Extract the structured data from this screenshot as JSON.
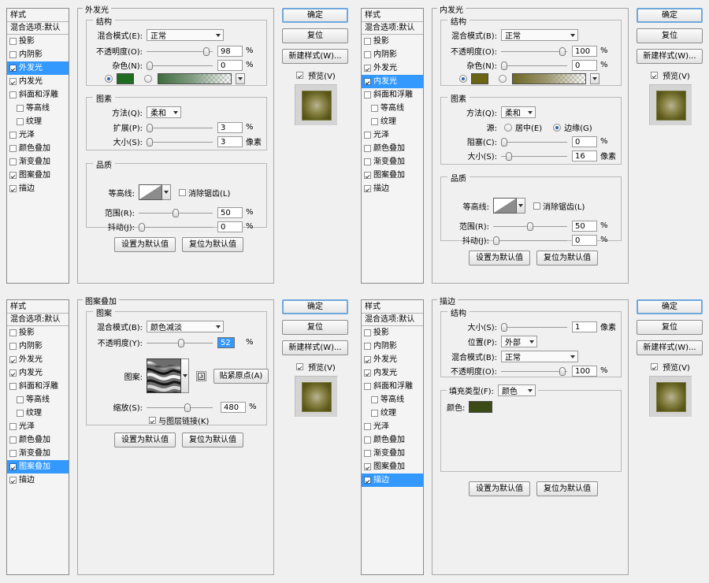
{
  "common": {
    "styles_title": "样式",
    "blend_options": "混合选项:默认",
    "effects": [
      {
        "label": "投影",
        "checked": false,
        "indent": false
      },
      {
        "label": "内阴影",
        "checked": false,
        "indent": false
      },
      {
        "label": "外发光",
        "checked": true,
        "indent": false
      },
      {
        "label": "内发光",
        "checked": true,
        "indent": false
      },
      {
        "label": "斜面和浮雕",
        "checked": false,
        "indent": false
      },
      {
        "label": "等高线",
        "checked": false,
        "indent": true
      },
      {
        "label": "纹理",
        "checked": false,
        "indent": true
      },
      {
        "label": "光泽",
        "checked": false,
        "indent": false
      },
      {
        "label": "颜色叠加",
        "checked": false,
        "indent": false
      },
      {
        "label": "渐变叠加",
        "checked": false,
        "indent": false
      },
      {
        "label": "图案叠加",
        "checked": true,
        "indent": false
      },
      {
        "label": "描边",
        "checked": true,
        "indent": false
      }
    ],
    "buttons": {
      "ok": "确定",
      "reset": "复位",
      "new_style": "新建样式(W)...",
      "preview": "预览(V)",
      "set_default": "设置为默认值",
      "reset_default": "复位为默认值"
    },
    "preview_checked": true,
    "group_structure": "结构",
    "group_elements": "图素",
    "group_quality": "品质",
    "label_blend_mode": "混合模式",
    "label_opacity": "不透明度",
    "label_noise": "杂色",
    "label_method": "方法",
    "label_contour": "等高线",
    "label_antialias": "消除锯齿(L)",
    "label_range": "范围",
    "label_jitter": "抖动",
    "unit_percent": "%",
    "unit_pixel": "像素",
    "accent_selection": "#3399ff"
  },
  "panels": [
    {
      "id": "outer-glow",
      "title": "外发光",
      "selected_effect": "外发光",
      "selected_index": 2,
      "structure": {
        "blend_mode_label": "混合模式(E):",
        "blend_mode_value": "正常",
        "opacity_label": "不透明度(O):",
        "opacity_value": "98",
        "opacity_pct": 98,
        "noise_label": "杂色(N):",
        "noise_value": "0",
        "noise_pct": 0,
        "color_mode": "solid",
        "color": "#1f6b1f",
        "gradient_from": "#4a7a4a",
        "gradient_to": "transparent"
      },
      "elements": {
        "method_label": "方法(Q):",
        "method_value": "柔和",
        "spread_label": "扩展(P):",
        "spread_value": "3",
        "spread_pct": 3,
        "size_label": "大小(S):",
        "size_value": "3",
        "size_pct": 2,
        "size_unit": "像素"
      },
      "quality": {
        "contour_label": "等高线:",
        "antialias_label": "消除锯齿(L)",
        "antialias_checked": false,
        "range_label": "范围(R):",
        "range_value": "50",
        "range_pct": 50,
        "jitter_label": "抖动(J):",
        "jitter_value": "0",
        "jitter_pct": 0
      }
    },
    {
      "id": "inner-glow",
      "title": "内发光",
      "selected_effect": "内发光",
      "selected_index": 3,
      "structure": {
        "blend_mode_label": "混合模式(B):",
        "blend_mode_value": "正常",
        "opacity_label": "不透明度(O):",
        "opacity_value": "100",
        "opacity_pct": 100,
        "noise_label": "杂色(N):",
        "noise_value": "0",
        "noise_pct": 0,
        "color_mode": "solid",
        "color": "#6b6413",
        "gradient_from": "#7d7640",
        "gradient_to": "transparent"
      },
      "elements": {
        "method_label": "方法(Q):",
        "method_value": "柔和",
        "source_label": "源:",
        "source_center_label": "居中(E)",
        "source_edge_label": "边缘(G)",
        "source_value": "edge",
        "choke_label": "阻塞(C):",
        "choke_value": "0",
        "choke_pct": 0,
        "size_label": "大小(S):",
        "size_value": "16",
        "size_pct": 7,
        "size_unit": "像素"
      },
      "quality": {
        "contour_label": "等高线:",
        "antialias_label": "消除锯齿(L)",
        "antialias_checked": false,
        "range_label": "范围(R):",
        "range_value": "50",
        "range_pct": 50,
        "jitter_label": "抖动(J):",
        "jitter_value": "0",
        "jitter_pct": 0
      }
    },
    {
      "id": "pattern-overlay",
      "title": "图案叠加",
      "selected_effect": "图案叠加",
      "selected_index": 10,
      "group_pattern": "图案",
      "pattern": {
        "blend_mode_label": "混合模式(B):",
        "blend_mode_value": "颜色减淡",
        "opacity_label": "不透明度(Y):",
        "opacity_value": "52",
        "opacity_pct": 52,
        "opacity_highlighted": true,
        "pattern_label": "图案:",
        "snap_button": "贴紧原点(A)",
        "scale_label": "缩放(S):",
        "scale_value": "480",
        "scale_pct": 48,
        "link_label": "与图层链接(K)",
        "link_checked": true
      }
    },
    {
      "id": "stroke",
      "title": "描边",
      "selected_effect": "描边",
      "selected_index": 11,
      "structure": {
        "size_label": "大小(S):",
        "size_value": "1",
        "size_pct": 1,
        "size_unit": "像素",
        "position_label": "位置(P):",
        "position_value": "外部",
        "blend_mode_label": "混合模式(B):",
        "blend_mode_value": "正常",
        "opacity_label": "不透明度(O):",
        "opacity_value": "100",
        "opacity_pct": 100
      },
      "fill": {
        "fill_type_label": "填充类型(F):",
        "fill_type_value": "颜色",
        "color_label": "颜色:",
        "color": "#3c4a17"
      }
    }
  ]
}
